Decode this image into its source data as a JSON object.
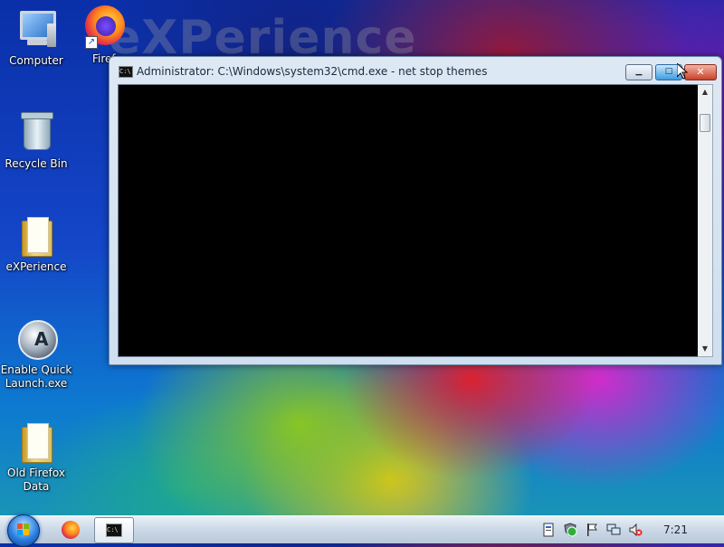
{
  "desktop": {
    "watermark": "eXPerience",
    "icons": [
      {
        "label": "Computer",
        "icon": "computer-icon"
      },
      {
        "label": "Firef",
        "icon": "firefox-icon"
      },
      {
        "label": "Recycle Bin",
        "icon": "recycle-bin-icon"
      },
      {
        "label": "eXPerience",
        "icon": "folder-icon"
      },
      {
        "label": "Enable Quick Launch.exe",
        "icon": "aero-app-icon"
      },
      {
        "label": "Old Firefox Data",
        "icon": "folder-icon"
      }
    ]
  },
  "window": {
    "title": "Administrator: C:\\Windows\\system32\\cmd.exe - net  stop themes",
    "icon": "cmd-icon",
    "minimize_symbol": "▁",
    "maximize_symbol": "□",
    "close_symbol": "✕",
    "console_text": ""
  },
  "taskbar": {
    "start_icon": "windows-start-orb",
    "pinned": [
      "firefox-icon",
      "cmd-icon"
    ],
    "tray": [
      "document-icon",
      "security-shield-icon",
      "flag-icon",
      "network-icon",
      "volume-muted-icon"
    ],
    "clock": "7:21"
  },
  "colors": {
    "console_bg": "#000000",
    "taskbar_bg": "#cbd8e6",
    "close_red": "#c8422a"
  }
}
